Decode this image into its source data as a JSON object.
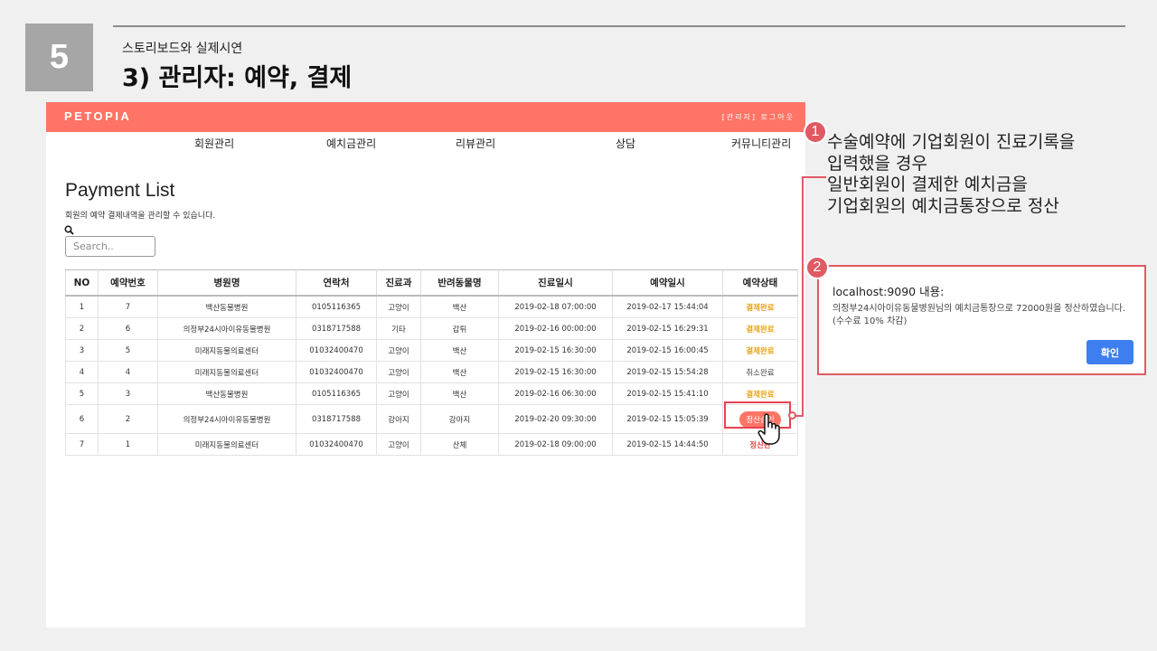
{
  "slide": {
    "number": "5",
    "subtitle": "스토리보드와 실제시연",
    "title": "3) 관리자: 예약, 결제"
  },
  "app": {
    "logo": "PETOPIA",
    "logout": "[관리자] 로그아웃",
    "nav": [
      "회원관리",
      "예치금관리",
      "리뷰관리",
      "상담",
      "커뮤니티관리"
    ],
    "page_title": "Payment List",
    "page_desc": "회원의 예약 결제내역을 관리할 수 있습니다.",
    "search_placeholder": "Search..",
    "table": {
      "headers": [
        "NO",
        "예약번호",
        "병원명",
        "연락처",
        "진료과",
        "반려동물명",
        "진료일시",
        "예약일시",
        "예약상태"
      ],
      "rows": [
        [
          "1",
          "7",
          "백산동물병원",
          "0105116365",
          "고양이",
          "백산",
          "2019-02-18 07:00:00",
          "2019-02-17 15:44:04",
          "결제완료"
        ],
        [
          "2",
          "6",
          "의정부24시아이유동물병원",
          "0318717588",
          "기타",
          "갑튀",
          "2019-02-16 00:00:00",
          "2019-02-15 16:29:31",
          "결제완료"
        ],
        [
          "3",
          "5",
          "미래지동물의료센터",
          "01032400470",
          "고양이",
          "백산",
          "2019-02-15 16:30:00",
          "2019-02-15 16:00:45",
          "결제완료"
        ],
        [
          "4",
          "4",
          "미래지동물의료센터",
          "01032400470",
          "고양이",
          "백산",
          "2019-02-15 16:30:00",
          "2019-02-15 15:54:28",
          "취소완료"
        ],
        [
          "5",
          "3",
          "백산동물병원",
          "0105116365",
          "고양이",
          "백산",
          "2019-02-16 06:30:00",
          "2019-02-15 15:41:10",
          "결제완료"
        ],
        [
          "6",
          "2",
          "의정부24시아이유동물병원",
          "0318717588",
          "강아지",
          "강아지",
          "2019-02-20 09:30:00",
          "2019-02-15 15:05:39",
          "정산승인"
        ],
        [
          "7",
          "1",
          "미래지동물의료센터",
          "01032400470",
          "고양이",
          "산체",
          "2019-02-18 09:00:00",
          "2019-02-15 14:44:50",
          "정산완"
        ]
      ]
    }
  },
  "callout1": {
    "number": "1",
    "lines": [
      "수술예약에 기업회원이 진료기록을",
      "입력했을 경우",
      "일반회원이 결제한 예치금을",
      "기업회원의 예치금통장으로 정산"
    ]
  },
  "callout2": {
    "number": "2",
    "dialog_title": "localhost:9090 내용:",
    "dialog_message": "의정부24시아이유동물병원님의 예치금통장으로 72000원을 정산하였습니다.(수수료 10% 차감)",
    "dialog_ok": "확인"
  },
  "colors": {
    "brand": "#ff7466",
    "callout": "#e05a64",
    "status_done": "#e8a317",
    "status_red": "#e04545",
    "ok_button": "#3d7ff0"
  },
  "icons": [
    "search-icon",
    "hand-pointer-icon"
  ]
}
